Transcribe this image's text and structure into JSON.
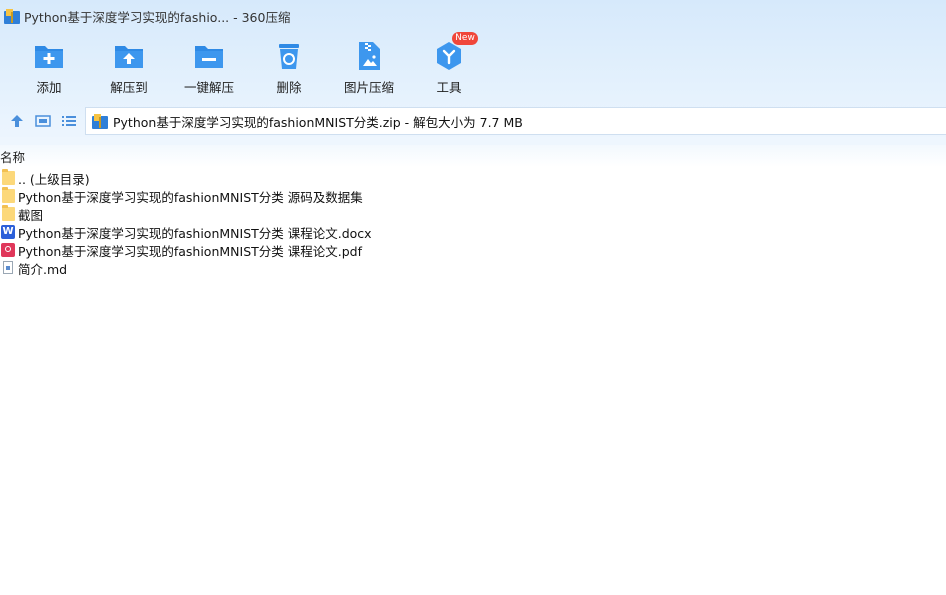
{
  "window": {
    "title": "Python基于深度学习实现的fashio... - 360压缩"
  },
  "toolbar": {
    "tools": [
      {
        "label": "添加",
        "icon": "add-folder-icon"
      },
      {
        "label": "解压到",
        "icon": "extract-to-icon"
      },
      {
        "label": "一键解压",
        "icon": "one-click-extract-icon"
      },
      {
        "label": "删除",
        "icon": "recycle-delete-icon"
      },
      {
        "label": "图片压缩",
        "icon": "image-compress-icon"
      },
      {
        "label": "工具",
        "icon": "tools-icon"
      }
    ],
    "badge": "New"
  },
  "nav": {
    "address": "Python基于深度学习实现的fashionMNIST分类.zip - 解包大小为 7.7 MB"
  },
  "list": {
    "column_name": "名称",
    "items": [
      {
        "name": ".. (上级目录)",
        "type": "folder"
      },
      {
        "name": "Python基于深度学习实现的fashionMNIST分类 源码及数据集",
        "type": "folder"
      },
      {
        "name": "截图",
        "type": "folder"
      },
      {
        "name": "Python基于深度学习实现的fashionMNIST分类 课程论文.docx",
        "type": "word"
      },
      {
        "name": "Python基于深度学习实现的fashionMNIST分类 课程论文.pdf",
        "type": "pdf"
      },
      {
        "name": "简介.md",
        "type": "md"
      }
    ]
  },
  "colors": {
    "accent": "#2f8ae5",
    "header_bg": "#d6e9fb",
    "folder": "#fcd87a",
    "word": "#2b5fd9",
    "pdf": "#e0375a",
    "badge": "#f0463a"
  }
}
